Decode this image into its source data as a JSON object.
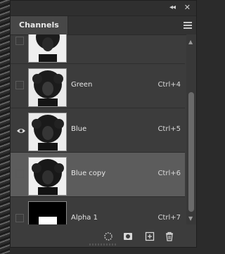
{
  "panel": {
    "tab_label": "Channels",
    "channels": [
      {
        "name": "",
        "shortcut": "",
        "visible": false
      },
      {
        "name": "Green",
        "shortcut": "Ctrl+4",
        "visible": false
      },
      {
        "name": "Blue",
        "shortcut": "Ctrl+5",
        "visible": true
      },
      {
        "name": "Blue copy",
        "shortcut": "Ctrl+6",
        "visible": false,
        "selected": true
      },
      {
        "name": "Alpha 1",
        "shortcut": "Ctrl+7",
        "visible": false
      }
    ]
  },
  "icons": {
    "collapse": "collapse-panel-icon",
    "close": "close-icon",
    "menu": "panel-menu-icon",
    "eye": "eye-icon",
    "load_selection": "dotted-circle-icon",
    "save_selection": "mask-icon",
    "new_channel": "new-channel-icon",
    "delete": "trash-icon"
  },
  "colors": {
    "panel_bg": "#3c3c3c",
    "selected_row": "#5c5c5c",
    "text": "#e6e6e6"
  }
}
